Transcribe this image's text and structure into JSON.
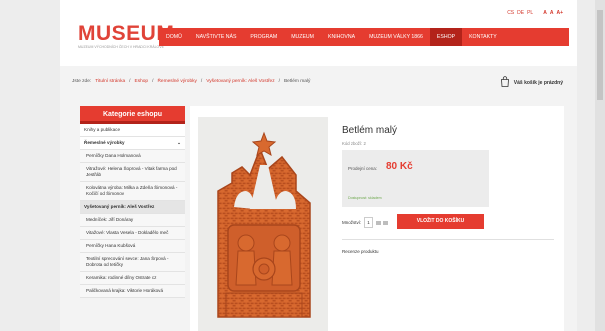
{
  "header": {
    "languages": [
      "CS",
      "DE",
      "PL"
    ],
    "font_size_controls": [
      "A",
      "A",
      "A+"
    ],
    "logo": {
      "word": "MUSEUM",
      "subtitle": "MUZEUM VÝCHODNÍCH ČECH V HRADCI KRÁLOVÉ"
    }
  },
  "nav": {
    "items": [
      "DOMŮ",
      "NAVŠTIVTE NÁS",
      "PROGRAM",
      "MUZEUM",
      "KNIHOVNA",
      "MUZEUM VÁLKY 1866",
      "ESHOP",
      "KONTAKTY"
    ],
    "active": "ESHOP"
  },
  "breadcrumb": {
    "prefix": "Jste zde:",
    "items": [
      "Titulní stránka",
      "Eshop",
      "Řemeslné výrobky",
      "Vyšetovaný perník: Aleš Vostřez"
    ],
    "current": "Betlém malý"
  },
  "cart": {
    "label": "Váš košík je prázdný"
  },
  "sidebar": {
    "title": "Kategorie eshopu",
    "items": [
      {
        "label": "Knihy a publikace",
        "type": "top"
      },
      {
        "label": "Řemeslné výrobky",
        "type": "open"
      },
      {
        "label": "Perníčky Dana Holmanová",
        "type": "sub"
      },
      {
        "label": "Vitražové: Helena Šoprová - Vitak farma pod Jestřáb",
        "type": "sub"
      },
      {
        "label": "Kolovátna výroba: Milka a Zdeňa Šimonová - Kočičí od Šimonov",
        "type": "sub"
      },
      {
        "label": "Vyšetovaný perník: Aleš Vostřez",
        "type": "hl"
      },
      {
        "label": "Medníček: Jiří Donáray",
        "type": "sub"
      },
      {
        "label": "Vitažové: Vlasta Vesela - Dokladělo meč",
        "type": "sub"
      },
      {
        "label": "Perníčky Hana Kubšová",
        "type": "sub"
      },
      {
        "label": "Textilní sprecování sevce: Jana Šrpová - Dobrota od tetičky",
        "type": "sub"
      },
      {
        "label": "Keramika: rodinné dílny Ostrate cz",
        "type": "sub"
      },
      {
        "label": "Paličkovaná krajka: Viktorie Horáková",
        "type": "sub"
      }
    ]
  },
  "product": {
    "title": "Betlém malý",
    "code": "Kód zboží: 2",
    "price_label": "Prodejní cena:",
    "price": "80 Kč",
    "stock": "Dostupnost: skladem",
    "qty_label": "Množství:",
    "qty": "1",
    "add_button": "VLOŽIT DO KOŠÍKU",
    "tab": "Recenze produktu"
  },
  "colors": {
    "accent": "#e53c30",
    "accent_dark": "#b3231a",
    "clay": "#d2642f"
  }
}
